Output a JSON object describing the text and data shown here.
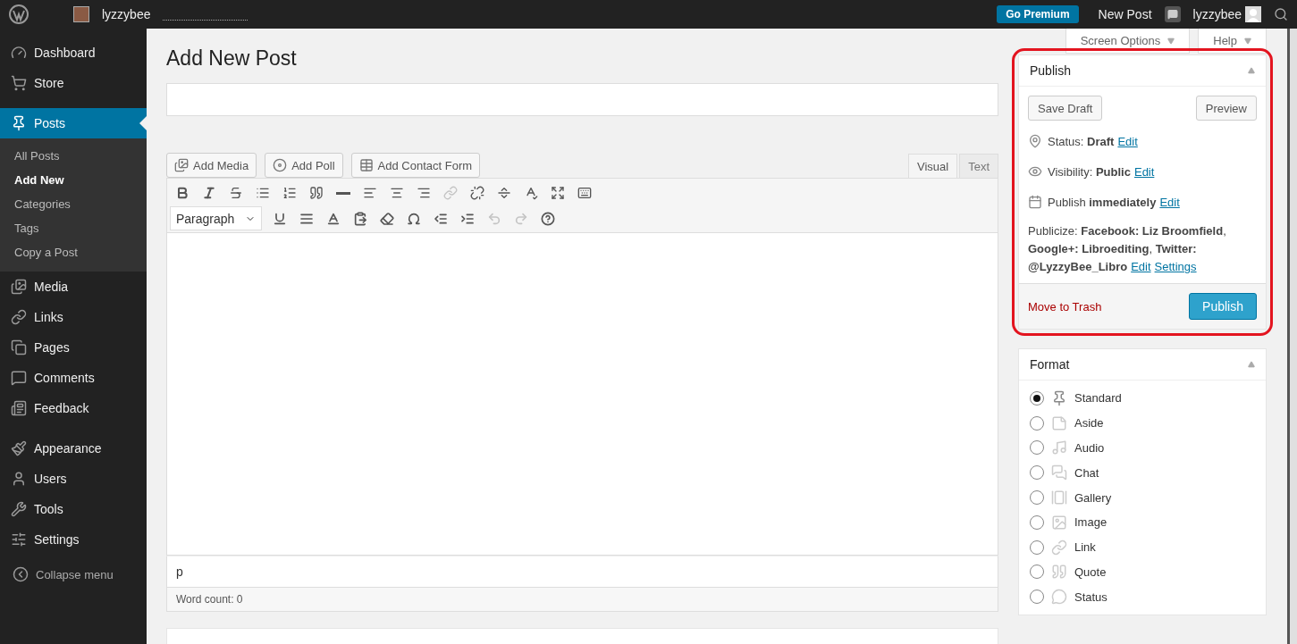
{
  "admin_bar": {
    "site_name": "lyzzybee",
    "premium_button": "Go Premium",
    "new_post": "New Post",
    "user_name": "lyzzybee"
  },
  "sidebar": {
    "items": [
      {
        "label": "Dashboard",
        "selected": false
      },
      {
        "label": "Store",
        "selected": false
      },
      {
        "label": "Posts",
        "selected": true,
        "children": [
          {
            "label": "All Posts",
            "selected": false
          },
          {
            "label": "Add New",
            "selected": true
          },
          {
            "label": "Categories",
            "selected": false
          },
          {
            "label": "Tags",
            "selected": false
          },
          {
            "label": "Copy a Post",
            "selected": false
          }
        ]
      },
      {
        "label": "Media",
        "selected": false
      },
      {
        "label": "Links",
        "selected": false
      },
      {
        "label": "Pages",
        "selected": false
      },
      {
        "label": "Comments",
        "selected": false
      },
      {
        "label": "Feedback",
        "selected": false
      },
      {
        "label": "Appearance",
        "selected": false
      },
      {
        "label": "Users",
        "selected": false
      },
      {
        "label": "Tools",
        "selected": false
      },
      {
        "label": "Settings",
        "selected": false
      }
    ],
    "collapse": "Collapse menu"
  },
  "screen_tabs": [
    "Screen Options",
    "Help"
  ],
  "page_title": "Add New Post",
  "editor": {
    "media_buttons": [
      "Add Media",
      "Add Poll",
      "Add Contact Form"
    ],
    "mode_tabs": [
      {
        "label": "Visual",
        "selected": true
      },
      {
        "label": "Text",
        "selected": false
      }
    ],
    "toolbar_row_1": [
      {
        "disabled": false
      },
      {
        "disabled": false
      },
      {
        "disabled": false
      },
      {
        "disabled": false
      },
      {
        "disabled": false
      },
      {
        "disabled": false
      },
      {
        "disabled": false
      },
      {
        "disabled": false
      },
      {
        "disabled": false
      },
      {
        "disabled": false
      },
      {
        "disabled": true
      },
      {
        "disabled": false
      },
      {
        "disabled": false
      },
      {
        "disabled": false
      },
      {
        "disabled": false
      },
      {
        "disabled": false
      }
    ],
    "format_select": "Paragraph",
    "toolbar_row_2": [
      {
        "disabled": false
      },
      {
        "disabled": false
      },
      {
        "disabled": false
      },
      {
        "disabled": false
      },
      {
        "disabled": false
      },
      {
        "disabled": false
      },
      {
        "disabled": false
      },
      {
        "disabled": false
      },
      {
        "disabled": true
      },
      {
        "disabled": true
      },
      {
        "disabled": false
      }
    ],
    "path": "p",
    "word_count": "Word count: 0"
  },
  "publish": {
    "title": "Publish",
    "highlighted": true,
    "save_draft": "Save Draft",
    "preview": "Preview",
    "rows": [
      {
        "text": "Status: **Draft**",
        "link": "Edit"
      },
      {
        "text": "Visibility: **Public**",
        "link": "Edit"
      },
      {
        "text": "Publish **immediately**",
        "link": "Edit"
      }
    ],
    "publicize": "Publicize: **Facebook: Liz Broomfield**, **Google+: Libroediting**, **Twitter: @LyzzyBee_Libro**",
    "publicize_links": [
      "Edit",
      "Settings"
    ],
    "trash": "Move to Trash",
    "publish_button": "Publish"
  },
  "format": {
    "title": "Format",
    "options": [
      {
        "label": "Standard",
        "selected": true
      },
      {
        "label": "Aside",
        "selected": false
      },
      {
        "label": "Audio",
        "selected": false
      },
      {
        "label": "Chat",
        "selected": false
      },
      {
        "label": "Gallery",
        "selected": false
      },
      {
        "label": "Image",
        "selected": false
      },
      {
        "label": "Link",
        "selected": false
      },
      {
        "label": "Quote",
        "selected": false
      },
      {
        "label": "Status",
        "selected": false
      }
    ]
  }
}
